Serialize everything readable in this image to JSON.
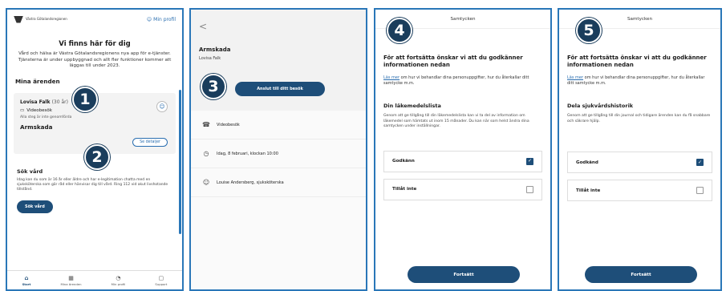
{
  "markers": [
    "1",
    "2",
    "3",
    "4",
    "5"
  ],
  "screen1": {
    "logo_text": "Västra Götalandsregionen",
    "profile_link": "Min profil",
    "hero_title": "Vi finns här för dig",
    "hero_text": "Vård och hälsa är Västra Götalandsregionens nya app för e-tjänster. Tjänsterna är under uppbyggnad och allt fler funktioner kommer att läggas till under 2023.",
    "section_title": "Mina ärenden",
    "errand": {
      "name": "Lovisa Falk",
      "age": "(30 år)",
      "type": "Videobesök",
      "status": "Alla steg är inte genomförda",
      "title": "Armskada",
      "details_button": "Se detaljer"
    },
    "seek": {
      "title": "Sök vård",
      "text": "Idag kan du som är 16 år eller äldre och har e-legitimation chatta med en sjuksköterska som gör råd eller hänvisar dig till vård. Ring 112 vid akut livshotande tillstånd.",
      "button": "Sök vård"
    },
    "nav": [
      {
        "label": "Start",
        "icon": "⌂"
      },
      {
        "label": "Mina ärenden",
        "icon": "▦"
      },
      {
        "label": "Min profil",
        "icon": "◔"
      },
      {
        "label": "Support",
        "icon": "▢"
      }
    ]
  },
  "screen2": {
    "back": "<",
    "title": "Armskada",
    "patient": "Lovisa Falk",
    "join_button": "Anslut till ditt besök",
    "rows": [
      {
        "icon": "☎",
        "text": "Videobesök"
      },
      {
        "icon": "◷",
        "text": "Idag, 8 februari, klockan 10:00"
      },
      {
        "icon": "☺",
        "text": "Louise Andersberg, sjuksköterska"
      }
    ]
  },
  "screen3": {
    "header": "Samtycken",
    "title": "För att fortsätta önskar vi att du godkänner informationen nedan",
    "intro_link": "Läs mer",
    "intro_rest": " om hur vi behandlar dina personuppgifter, hur du återkallar ditt samtycke m.m.",
    "section_title": "Din läkemedelslista",
    "section_text": "Genom att ge tillgång till din läkemedelslista kan vi ta del av information om läkemedel som hämtats ut inom 15 månader. Du kan när som helst ändra dina samtycken under inställningar.",
    "approve": "Godkänn",
    "deny": "Tillåt inte",
    "continue": "Fortsätt"
  },
  "screen4": {
    "header": "Samtycken",
    "title": "För att fortsätta önskar vi att du godkänner informationen nedan",
    "intro_link": "Läs mer",
    "intro_rest": " om hur vi behandlar dina personuppgifter, hur du återkallar ditt samtycke m.m.",
    "section_title": "Dela sjukvårdshistorik",
    "section_text": "Genom att ge tillgång till din journal och tidigare ärenden kan du få snabbare och säkrare hjälp.",
    "approve": "Godkänd",
    "deny": "Tillåt inte",
    "continue": "Fortsätt"
  }
}
